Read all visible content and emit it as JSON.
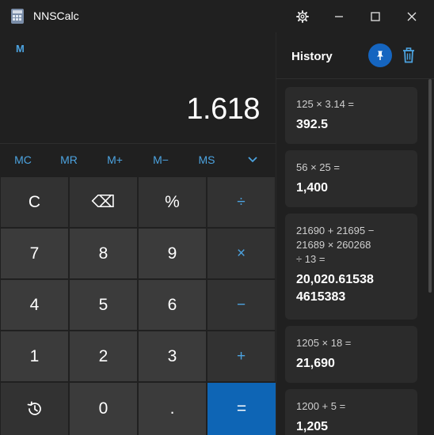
{
  "window": {
    "title": "NNSCalc",
    "settings_icon": "gear-icon",
    "minimize_icon": "minimize-icon",
    "maximize_icon": "maximize-icon",
    "close_icon": "close-icon"
  },
  "calculator": {
    "memory_indicator": "M",
    "display_value": "1.618",
    "memory_buttons": [
      "MC",
      "MR",
      "M+",
      "M−",
      "MS"
    ],
    "memory_dropdown_icon": "chevron-down-icon",
    "keys": {
      "clear": "C",
      "backspace": "⌫",
      "percent": "%",
      "divide": "÷",
      "seven": "7",
      "eight": "8",
      "nine": "9",
      "multiply": "×",
      "four": "4",
      "five": "5",
      "six": "6",
      "minus": "−",
      "one": "1",
      "two": "2",
      "three": "3",
      "plus": "+",
      "history_icon": "history-icon",
      "zero": "0",
      "decimal": ".",
      "equals": "="
    }
  },
  "history": {
    "title": "History",
    "pin_icon": "pin-icon",
    "delete_icon": "trash-icon",
    "items": [
      {
        "expression": "125 × 3.14 =",
        "result": "392.5"
      },
      {
        "expression": "56 × 25 =",
        "result": "1,400"
      },
      {
        "expression": "21690 + 21695 −\n21689 × 260268\n÷ 13 =",
        "result": "20,020.61538\n4615383"
      },
      {
        "expression": "1205 × 18 =",
        "result": "21,690"
      },
      {
        "expression": "1200 + 5 =",
        "result": "1,205"
      }
    ]
  },
  "colors": {
    "accent": "#4ca3e0",
    "equals_button": "#0e65b5",
    "pin_button": "#1565c0"
  }
}
